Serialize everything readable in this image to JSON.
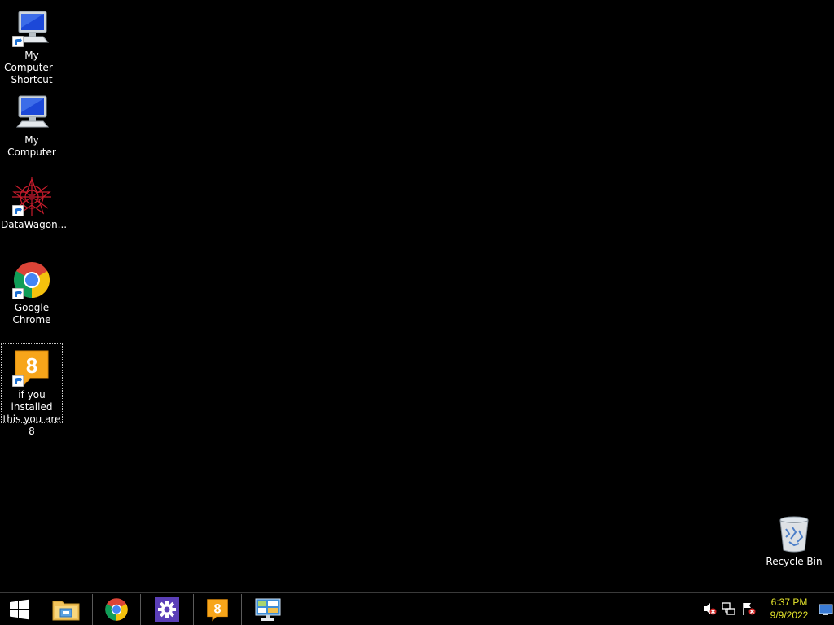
{
  "desktop": {
    "icons": [
      {
        "label": "My Computer - Shortcut",
        "icon": "my-computer-icon",
        "shortcut": true
      },
      {
        "label": "My Computer",
        "icon": "my-computer-icon",
        "shortcut": false
      },
      {
        "label": "DataWagon...",
        "icon": "datawagon-icon",
        "shortcut": true
      },
      {
        "label": "Google Chrome",
        "icon": "chrome-icon",
        "shortcut": true
      },
      {
        "label": "if you installed this you are 8",
        "icon": "scratch-8-icon",
        "shortcut": true,
        "selected": true
      }
    ],
    "recycle_bin": {
      "label": "Recycle Bin",
      "icon": "recycle-bin-icon"
    }
  },
  "taskbar": {
    "start_icon": "windows-logo-icon",
    "pinned": [
      {
        "name": "File Explorer",
        "icon": "folder-icon"
      },
      {
        "name": "Google Chrome",
        "icon": "chrome-icon"
      },
      {
        "name": "Settings",
        "icon": "gear-icon"
      },
      {
        "name": "if you installed this you are 8",
        "icon": "scratch-8-icon"
      },
      {
        "name": "Control Panel",
        "icon": "control-panel-icon"
      }
    ],
    "tray": {
      "icons": [
        "volume-muted-icon",
        "network-disconnected-icon",
        "action-center-flag-icon"
      ],
      "time": "6:37 PM",
      "date": "9/9/2022",
      "show_desktop_icon": "show-desktop-icon"
    }
  },
  "colors": {
    "background": "#000000",
    "clock_text": "#e6e62c",
    "label_text": "#ffffff"
  }
}
